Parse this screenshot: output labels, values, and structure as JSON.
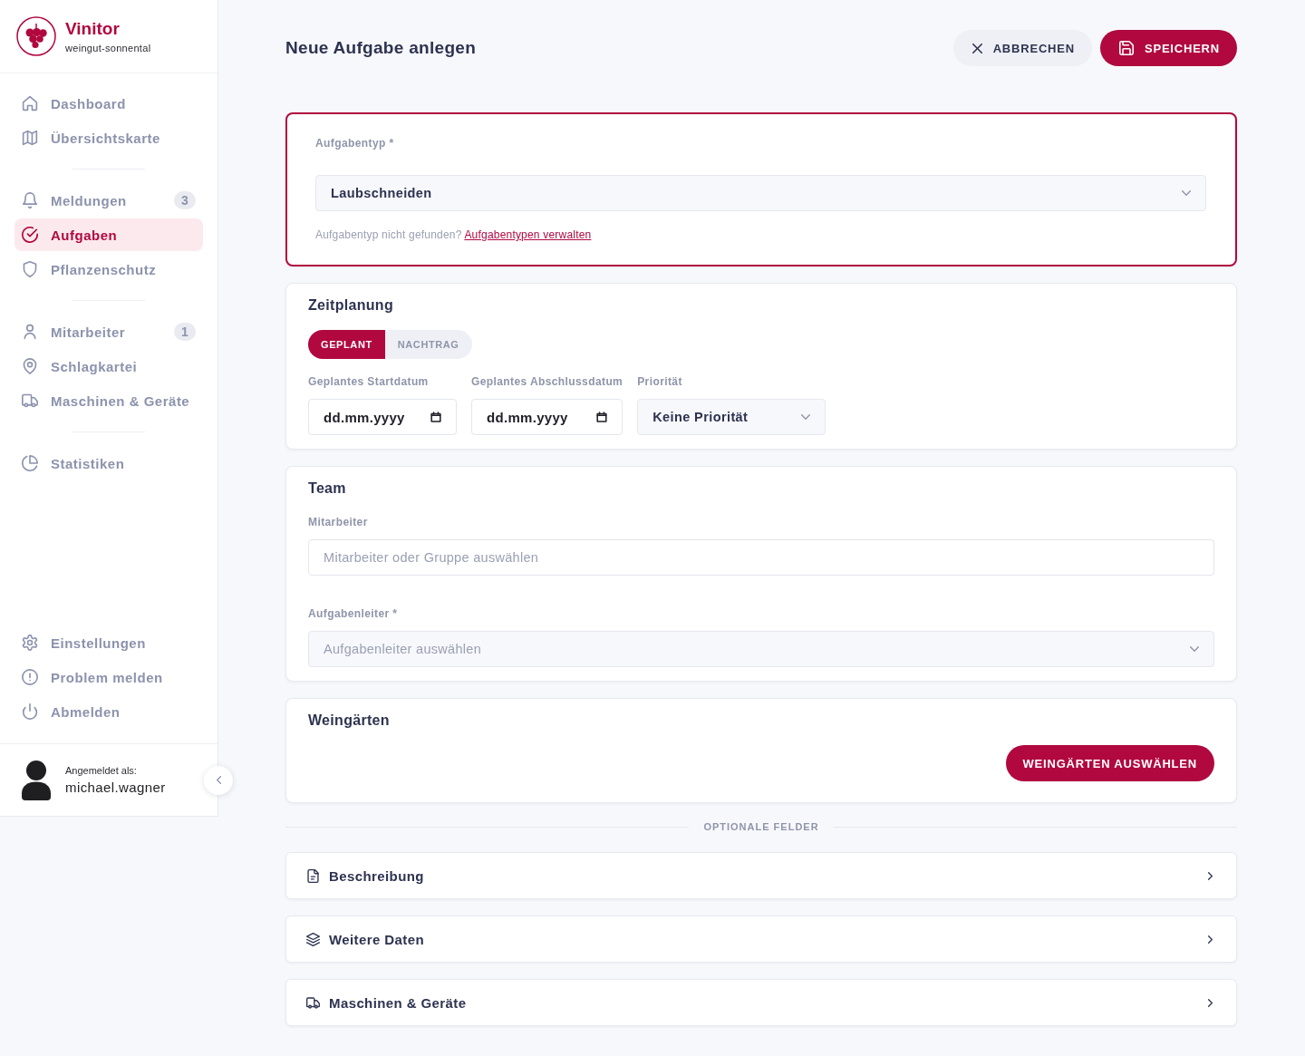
{
  "sidebar": {
    "brand": {
      "name": "Vinitor",
      "workspace": "weingut-sonnental"
    },
    "nav_groups": [
      {
        "items": [
          {
            "label": "Dashboard",
            "selected": false
          },
          {
            "label": "Übersichtskarte",
            "selected": false
          }
        ]
      },
      {
        "items": [
          {
            "label": "Meldungen",
            "badge": "3",
            "selected": false
          },
          {
            "label": "Aufgaben",
            "selected": true
          },
          {
            "label": "Pflanzenschutz",
            "selected": false
          }
        ]
      },
      {
        "items": [
          {
            "label": "Mitarbeiter",
            "badge": "1",
            "selected": false
          },
          {
            "label": "Schlagkartei",
            "selected": false
          },
          {
            "label": "Maschinen & Geräte",
            "selected": false
          }
        ]
      },
      {
        "items": [
          {
            "label": "Statistiken",
            "selected": false
          }
        ]
      }
    ],
    "footer_items": [
      {
        "label": "Einstellungen"
      },
      {
        "label": "Problem melden"
      },
      {
        "label": "Abmelden"
      }
    ],
    "user": {
      "caption": "Angemeldet als:",
      "name": "michael.wagner"
    }
  },
  "header": {
    "title": "Neue Aufgabe anlegen",
    "buttons": [
      {
        "label": "ABBRECHEN",
        "kind": "secondary"
      },
      {
        "label": "SPEICHERN",
        "kind": "primary"
      }
    ]
  },
  "task_type": {
    "label": "Aufgabentyp *",
    "value": "Laubschneiden",
    "help": {
      "text": "Aufgabentyp nicht gefunden?",
      "link": "Aufgabentypen verwalten"
    }
  },
  "scheduling": {
    "title": "Zeitplanung",
    "modes": [
      {
        "label": "GEPLANT",
        "selected": true
      },
      {
        "label": "NACHTRAG",
        "selected": false
      }
    ],
    "fields": [
      {
        "label": "Geplantes Startdatum",
        "kind": "date",
        "placeholder": "dd.mm.yyyy"
      },
      {
        "label": "Geplantes Abschlussdatum",
        "kind": "date",
        "placeholder": "dd.mm.yyyy"
      },
      {
        "label": "Priorität",
        "kind": "select",
        "value": "Keine Priorität"
      }
    ]
  },
  "team": {
    "title": "Team",
    "fields": [
      {
        "label": "Mitarbeiter",
        "kind": "text",
        "placeholder": "Mitarbeiter oder Gruppe auswählen"
      },
      {
        "label": "Aufgabenleiter *",
        "kind": "select",
        "placeholder": "Aufgabenleiter auswählen"
      }
    ]
  },
  "vineyards": {
    "title": "Weingärten",
    "button": "WEINGÄRTEN AUSWÄHLEN"
  },
  "optional": {
    "heading": "OPTIONALE FELDER",
    "sections": [
      {
        "label": "Beschreibung",
        "expanded": false
      },
      {
        "label": "Weitere Daten",
        "expanded": false
      },
      {
        "label": "Maschinen & Geräte",
        "expanded": false
      }
    ]
  }
}
